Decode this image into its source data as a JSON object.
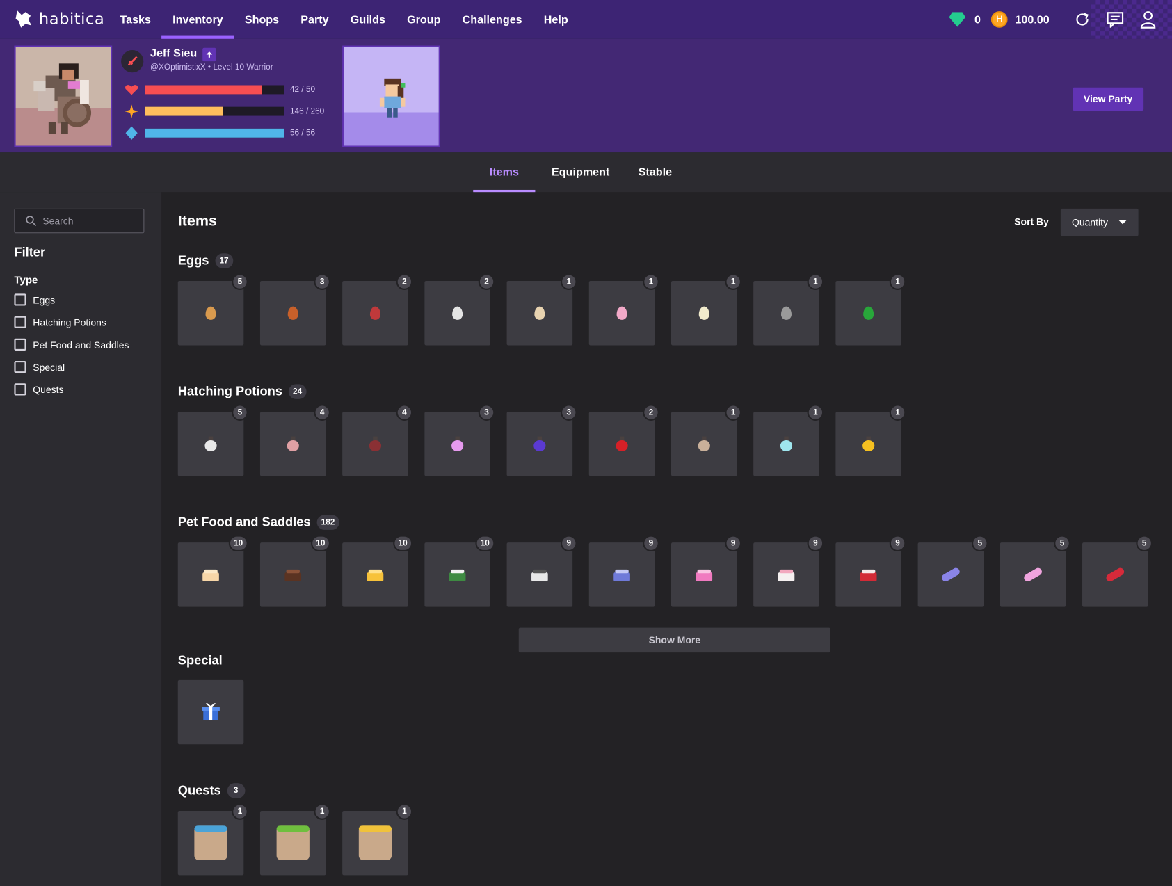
{
  "nav": {
    "logo_text": "habitica",
    "links": [
      "Tasks",
      "Inventory",
      "Shops",
      "Party",
      "Guilds",
      "Group",
      "Challenges",
      "Help"
    ],
    "active": "Inventory",
    "gems": "0",
    "gold": "100.00"
  },
  "user": {
    "name": "Jeff Sieu",
    "subtitle": "@XOptimistixX • Level 10 Warrior",
    "health": {
      "text": "42 / 50",
      "value": 42,
      "max": 50,
      "color": "#f74e52"
    },
    "experience": {
      "text": "146 / 260",
      "value": 146,
      "max": 260,
      "color": "#ffbe5d"
    },
    "mana": {
      "text": "56 / 56",
      "value": 56,
      "max": 56,
      "color": "#50b5e9"
    },
    "view_party": "View Party"
  },
  "tabs": [
    "Items",
    "Equipment",
    "Stable"
  ],
  "active_tab": "Items",
  "sidebar": {
    "search_placeholder": "Search",
    "filter_title": "Filter",
    "type_title": "Type",
    "types": [
      "Eggs",
      "Hatching Potions",
      "Pet Food and Saddles",
      "Special",
      "Quests"
    ]
  },
  "main": {
    "title": "Items",
    "sort_label": "Sort By",
    "sort_value": "Quantity",
    "show_more": "Show More"
  },
  "sections": {
    "eggs": {
      "title": "Eggs",
      "count": "17",
      "items": [
        {
          "qty": "5",
          "color": "#d99a4e"
        },
        {
          "qty": "3",
          "color": "#c8602a"
        },
        {
          "qty": "2",
          "color": "#c0393b"
        },
        {
          "qty": "2",
          "color": "#e4e4e4"
        },
        {
          "qty": "1",
          "color": "#e8d3b0"
        },
        {
          "qty": "1",
          "color": "#f2a9c8"
        },
        {
          "qty": "1",
          "color": "#f1ebcc"
        },
        {
          "qty": "1",
          "color": "#9a9a9a"
        },
        {
          "qty": "1",
          "color": "#28a63a"
        }
      ]
    },
    "potions": {
      "title": "Hatching Potions",
      "count": "24",
      "items": [
        {
          "qty": "5",
          "color": "#e8e8e8"
        },
        {
          "qty": "4",
          "color": "#e0a0a4"
        },
        {
          "qty": "4",
          "color": "#8a3034"
        },
        {
          "qty": "3",
          "color": "#e69aee"
        },
        {
          "qty": "3",
          "color": "#5b3ad1"
        },
        {
          "qty": "2",
          "color": "#d62027"
        },
        {
          "qty": "1",
          "color": "#c9b09a"
        },
        {
          "qty": "1",
          "color": "#9fe6ee"
        },
        {
          "qty": "1",
          "color": "#f5c020"
        }
      ]
    },
    "food": {
      "title": "Pet Food and Saddles",
      "count": "182",
      "items": [
        {
          "qty": "10",
          "kind": "cake",
          "color": "#f7d6a8",
          "top": "#fbe8c8"
        },
        {
          "qty": "10",
          "kind": "cake",
          "color": "#5a3322",
          "top": "#8a5238"
        },
        {
          "qty": "10",
          "kind": "cake",
          "color": "#f7c23a",
          "top": "#ffe08a"
        },
        {
          "qty": "10",
          "kind": "cake",
          "color": "#3e8a42",
          "top": "#f2f2f2"
        },
        {
          "qty": "9",
          "kind": "cake",
          "color": "#e8e8e8",
          "top": "#555555"
        },
        {
          "qty": "9",
          "kind": "cake",
          "color": "#6f7ad9",
          "top": "#c4c8f5"
        },
        {
          "qty": "9",
          "kind": "cake",
          "color": "#f07ac0",
          "top": "#f9c3e2"
        },
        {
          "qty": "9",
          "kind": "cake",
          "color": "#f5f0f0",
          "top": "#f2a8be"
        },
        {
          "qty": "9",
          "kind": "cake",
          "color": "#d32a36",
          "top": "#f5e8e8"
        },
        {
          "qty": "5",
          "kind": "candy",
          "color": "#8a84e8"
        },
        {
          "qty": "5",
          "kind": "candy",
          "color": "#f0a4de"
        },
        {
          "qty": "5",
          "kind": "candy",
          "color": "#d62a3a"
        }
      ]
    },
    "special": {
      "title": "Special",
      "items": [
        {
          "qty": "",
          "icon": "gift-icon"
        }
      ]
    },
    "quests": {
      "title": "Quests",
      "count": "3",
      "items": [
        {
          "qty": "1",
          "color": "#4aa3d8"
        },
        {
          "qty": "1",
          "color": "#6fbf3e"
        },
        {
          "qty": "1",
          "color": "#f0c23a"
        }
      ]
    }
  }
}
